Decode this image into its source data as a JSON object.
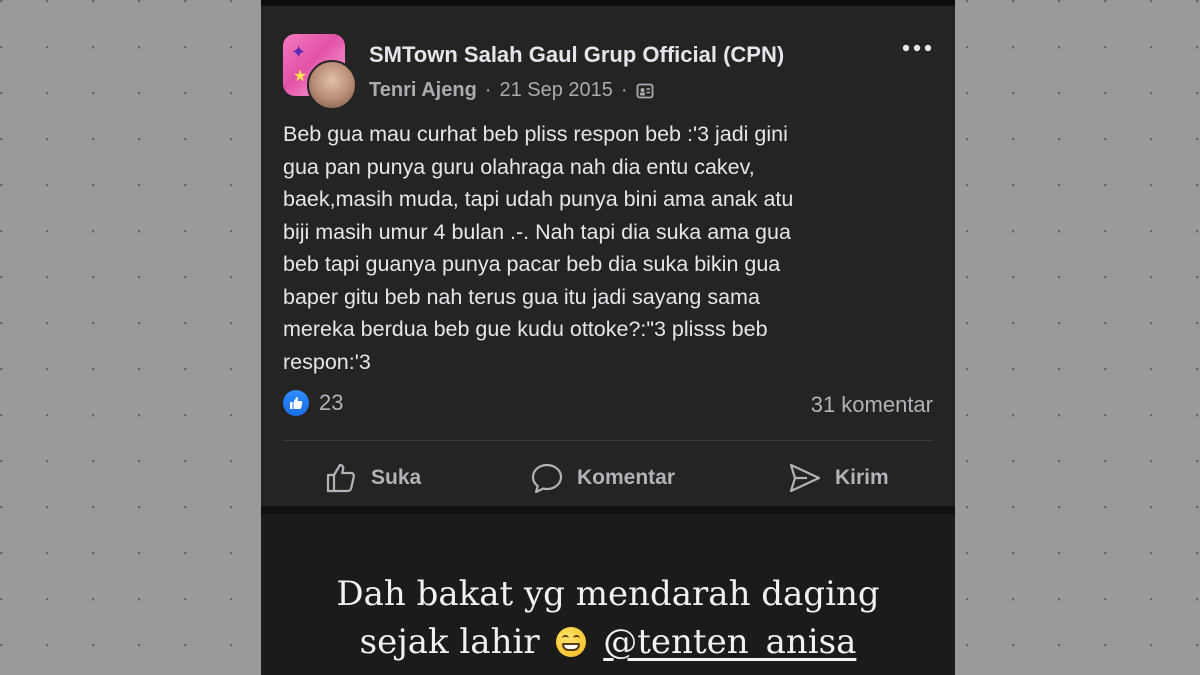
{
  "post": {
    "group_name": "SMTown Salah Gaul Grup Official (CPN)",
    "author": "Tenri Ajeng",
    "date": "21 Sep 2015",
    "separator": "·",
    "body": "Beb gua mau curhat beb pliss respon beb :'3 jadi gini\ngua pan punya guru olahraga nah dia entu cakev,\nbaek,masih muda, tapi udah punya bini ama anak atu\nbiji masih umur 4 bulan .-. Nah tapi dia suka ama gua\nbeb tapi guanya punya pacar beb dia suka bikin gua\nbaper gitu beb nah terus gua itu jadi sayang sama\nmereka berdua beb gue kudu ottoke?:\"3 plisss beb\nrespon:'3",
    "reaction_count": "23",
    "comment_count": "31 komentar",
    "icons": {
      "more": "more-dots-icon",
      "privacy": "group-privacy-icon",
      "reaction": "like-reaction-icon"
    }
  },
  "actions": {
    "like_label": "Suka",
    "comment_label": "Komentar",
    "send_label": "Kirim"
  },
  "caption": {
    "line1": "Dah bakat yg mendarah daging",
    "line2_prefix": "sejak lahir",
    "emoji": "grinning-face-icon",
    "mention": "@tenten_anisa"
  },
  "colors": {
    "background": "#9a9a9a",
    "card": "#242424",
    "text": "#e4e6eb",
    "muted": "#b0b3b8",
    "accent": "#1a6ee6"
  }
}
